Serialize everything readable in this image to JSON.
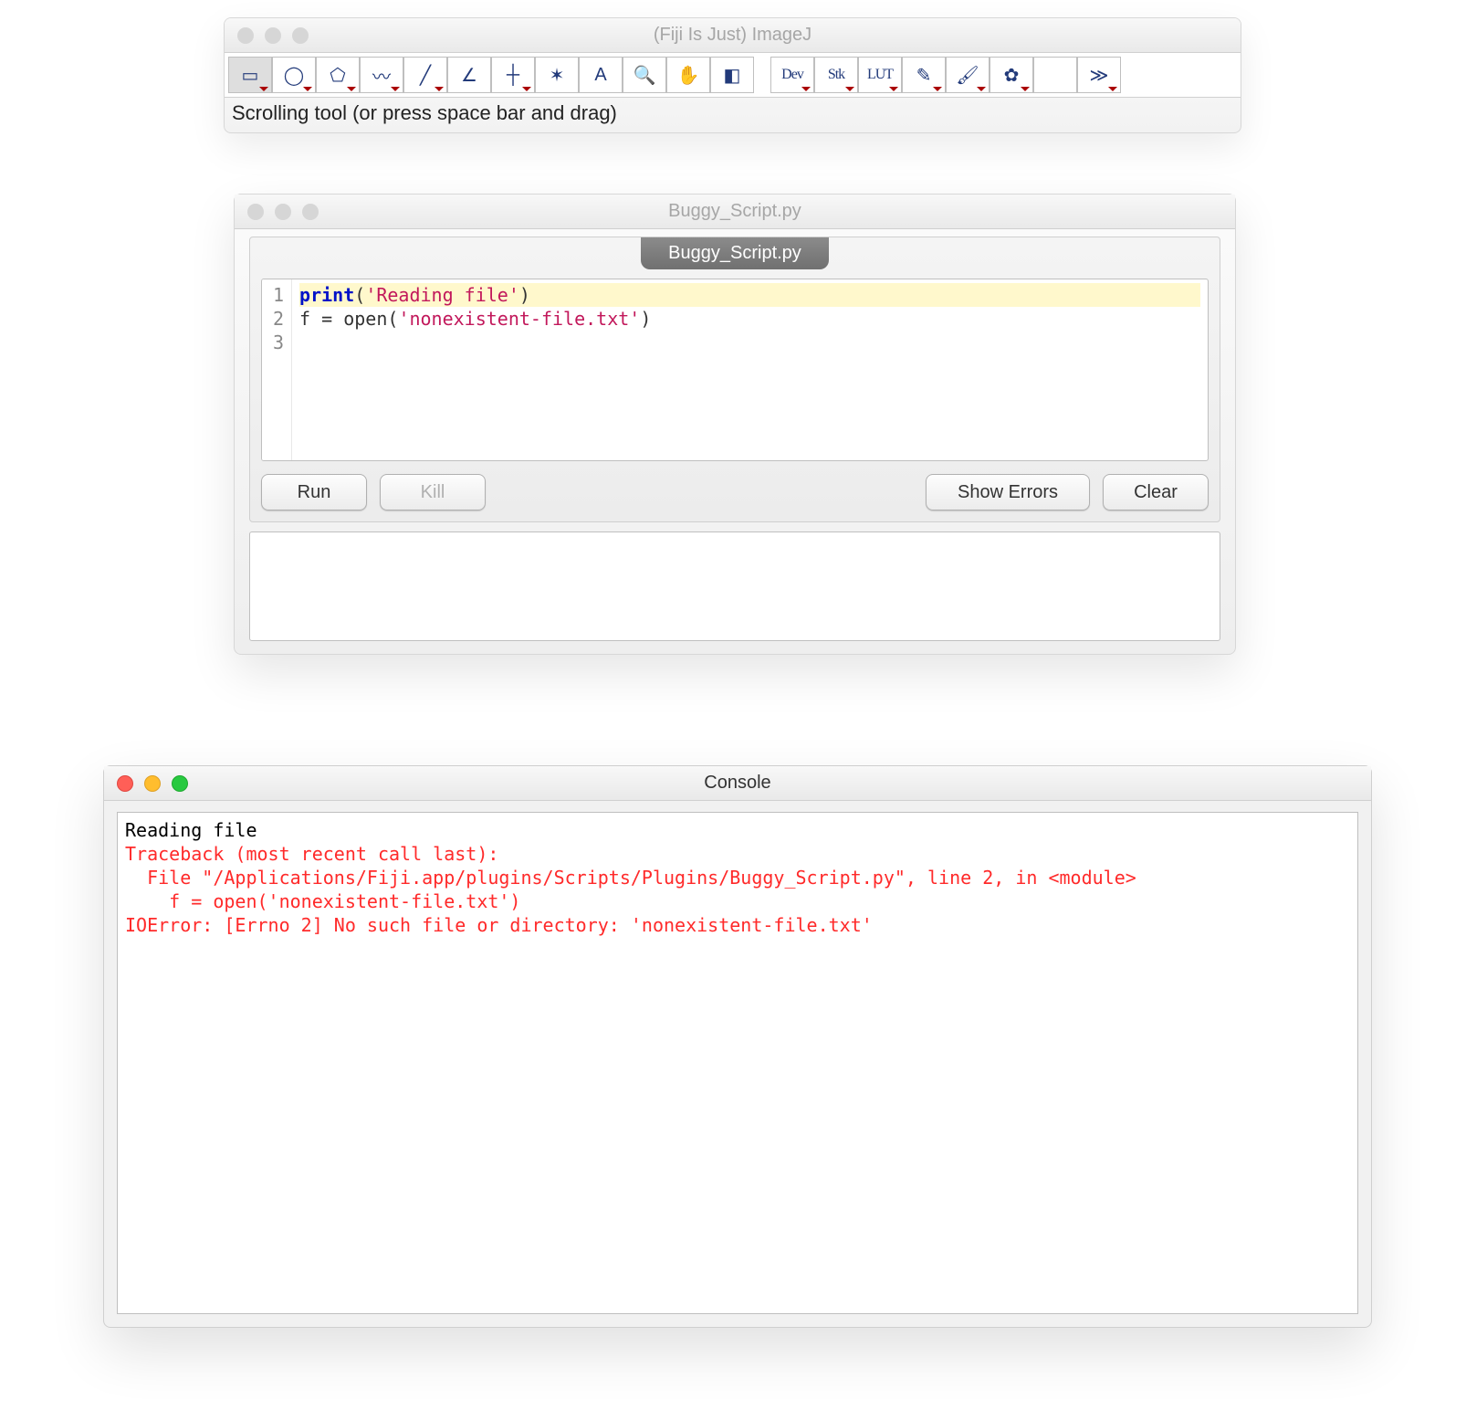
{
  "imagej": {
    "title": "(Fiji Is Just) ImageJ",
    "status": "Scrolling tool (or press space bar and drag)",
    "tools": [
      {
        "name": "rectangle-tool",
        "label": "▭",
        "marker": true,
        "selected": true
      },
      {
        "name": "oval-tool",
        "label": "◯",
        "marker": true
      },
      {
        "name": "polygon-tool",
        "label": "⬠",
        "marker": true
      },
      {
        "name": "freehand-tool",
        "label": "〰",
        "marker": true
      },
      {
        "name": "line-tool",
        "label": "╱",
        "marker": true
      },
      {
        "name": "angle-tool",
        "label": "∠",
        "marker": false
      },
      {
        "name": "point-tool",
        "label": "┼",
        "marker": true
      },
      {
        "name": "wand-tool",
        "label": "✶",
        "marker": false
      },
      {
        "name": "text-tool",
        "label": "A",
        "marker": false
      },
      {
        "name": "magnify-tool",
        "label": "🔍",
        "marker": false
      },
      {
        "name": "hand-tool",
        "label": "✋",
        "marker": false
      },
      {
        "name": "color-picker-tool",
        "label": "◧",
        "marker": false
      }
    ],
    "tools2": [
      {
        "name": "dev-tool",
        "label": "Dev",
        "marker": true
      },
      {
        "name": "stk-tool",
        "label": "Stk",
        "marker": true
      },
      {
        "name": "lut-tool",
        "label": "LUT",
        "marker": true
      },
      {
        "name": "pencil-tool",
        "label": "✎",
        "marker": true
      },
      {
        "name": "brush-tool",
        "label": "🖌",
        "marker": true
      },
      {
        "name": "spray-tool",
        "label": "✿",
        "marker": true
      },
      {
        "name": "blank-tool",
        "label": "",
        "marker": false
      },
      {
        "name": "more-tool",
        "label": "≫",
        "marker": true
      }
    ]
  },
  "scriptEditor": {
    "title": "Buggy_Script.py",
    "tab": "Buggy_Script.py",
    "lines": [
      {
        "n": "1",
        "tokens": [
          {
            "t": "print",
            "c": "kw"
          },
          {
            "t": "(",
            "c": "fn"
          },
          {
            "t": "'Reading file'",
            "c": "str"
          },
          {
            "t": ")",
            "c": "fn"
          }
        ],
        "hl": true
      },
      {
        "n": "2",
        "tokens": [
          {
            "t": "f ",
            "c": "fn"
          },
          {
            "t": "=",
            "c": "fn"
          },
          {
            "t": " open(",
            "c": "fn"
          },
          {
            "t": "'nonexistent-file.txt'",
            "c": "str"
          },
          {
            "t": ")",
            "c": "fn"
          }
        ]
      },
      {
        "n": "3",
        "tokens": []
      }
    ],
    "buttons": {
      "run": "Run",
      "kill": "Kill",
      "showErrors": "Show Errors",
      "clear": "Clear"
    }
  },
  "console": {
    "title": "Console",
    "lines": [
      {
        "text": "Reading file",
        "cls": "out"
      },
      {
        "text": "Traceback (most recent call last):",
        "cls": "err"
      },
      {
        "text": "  File \"/Applications/Fiji.app/plugins/Scripts/Plugins/Buggy_Script.py\", line 2, in <module>",
        "cls": "err"
      },
      {
        "text": "    f = open('nonexistent-file.txt')",
        "cls": "err"
      },
      {
        "text": "IOError: [Errno 2] No such file or directory: 'nonexistent-file.txt'",
        "cls": "err"
      }
    ]
  }
}
